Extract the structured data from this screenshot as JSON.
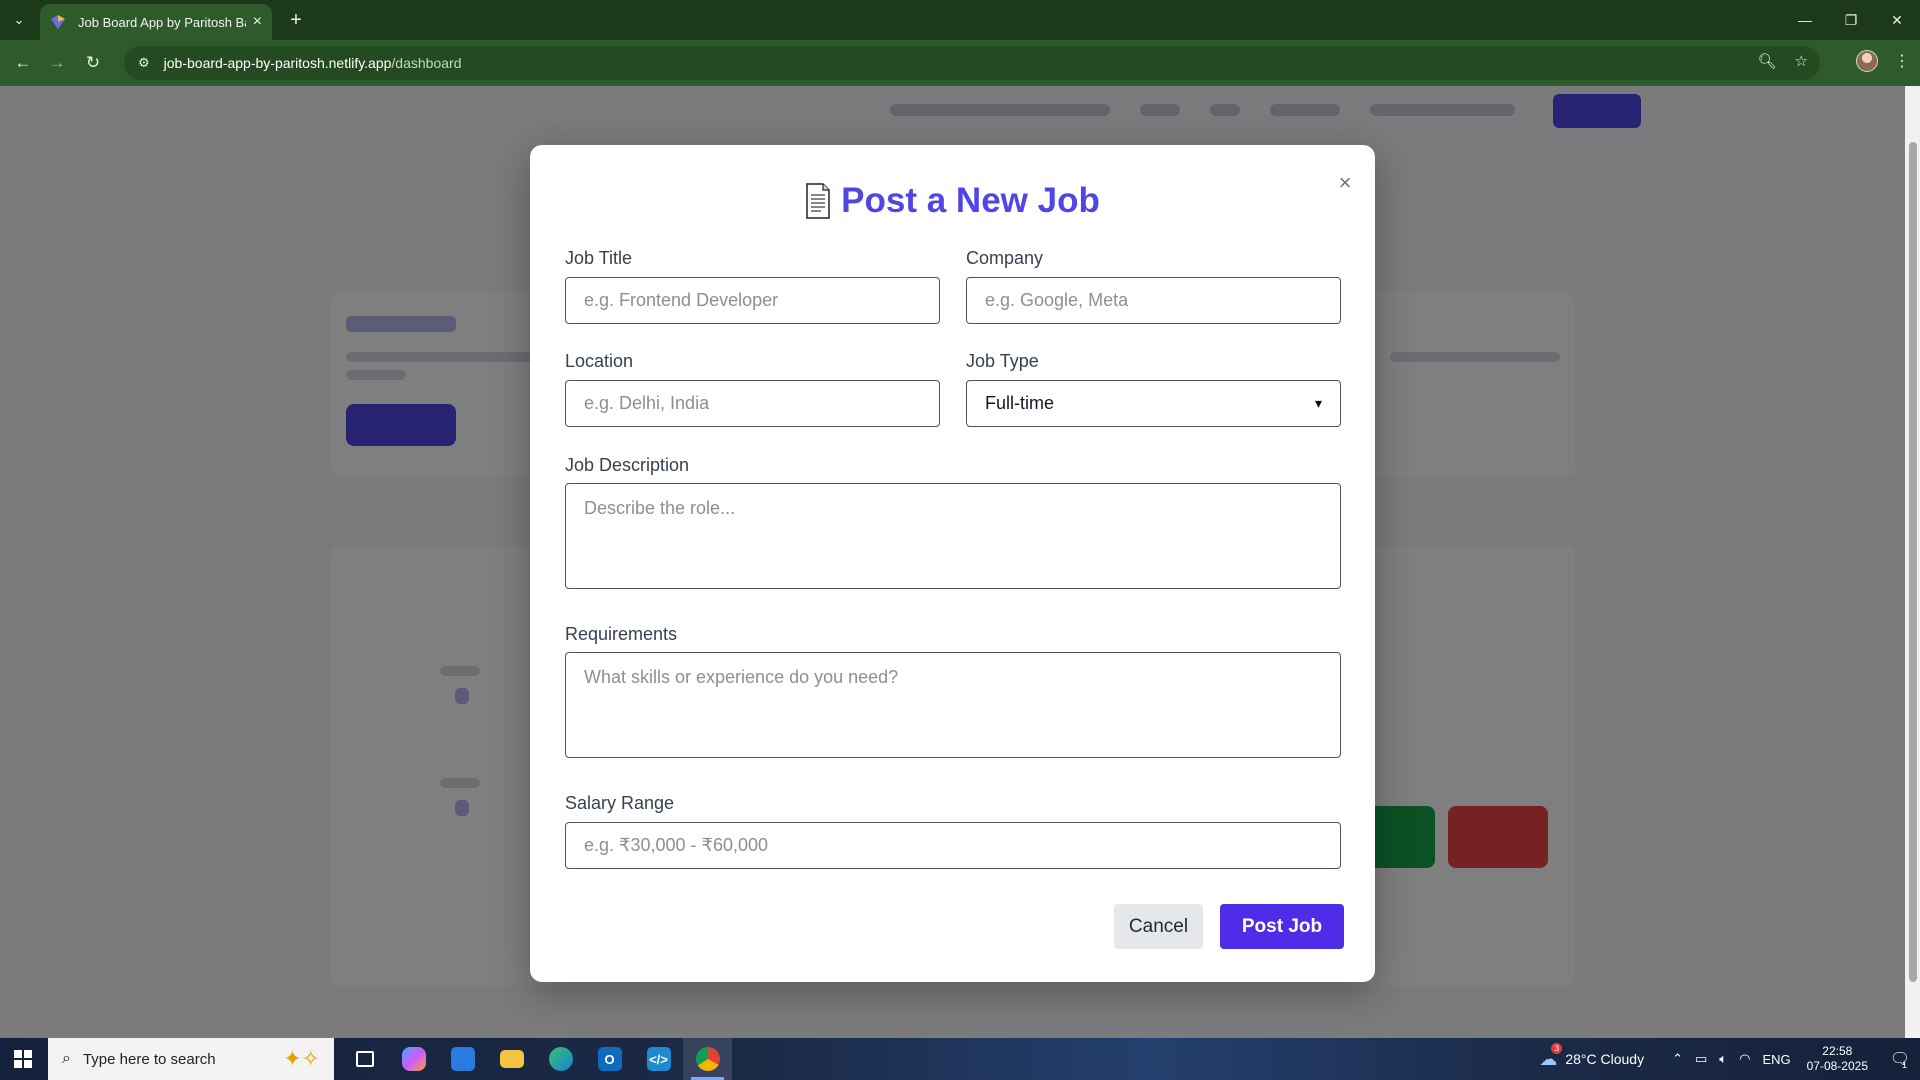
{
  "browser": {
    "tab_title": "Job Board App by Paritosh Bar",
    "url_host": "job-board-app-by-paritosh.netlify.app",
    "url_path": "/dashboard"
  },
  "modal": {
    "icon": "document-icon",
    "title": "Post a New Job",
    "close_label": "×",
    "fields": {
      "job_title": {
        "label": "Job Title",
        "placeholder": "e.g. Frontend Developer",
        "value": ""
      },
      "company": {
        "label": "Company",
        "placeholder": "e.g. Google, Meta",
        "value": ""
      },
      "location": {
        "label": "Location",
        "placeholder": "e.g. Delhi, India",
        "value": ""
      },
      "job_type": {
        "label": "Job Type",
        "selected": "Full-time"
      },
      "description": {
        "label": "Job Description",
        "placeholder": "Describe the role...",
        "value": ""
      },
      "requirements": {
        "label": "Requirements",
        "placeholder": "What skills or experience do you need?",
        "value": ""
      },
      "salary": {
        "label": "Salary Range",
        "placeholder": "e.g. ₹30,000 - ₹60,000",
        "value": ""
      }
    },
    "buttons": {
      "cancel": "Cancel",
      "submit": "Post Job"
    }
  },
  "taskbar": {
    "search_placeholder": "Type here to search",
    "weather": "28°C  Cloudy",
    "weather_badge": "3",
    "language": "ENG",
    "time": "22:58",
    "date": "07-08-2025",
    "notification_count": "1"
  },
  "colors": {
    "accent": "#4f46e5",
    "submit": "#4f2de8",
    "chrome": "#2f5a2b"
  }
}
